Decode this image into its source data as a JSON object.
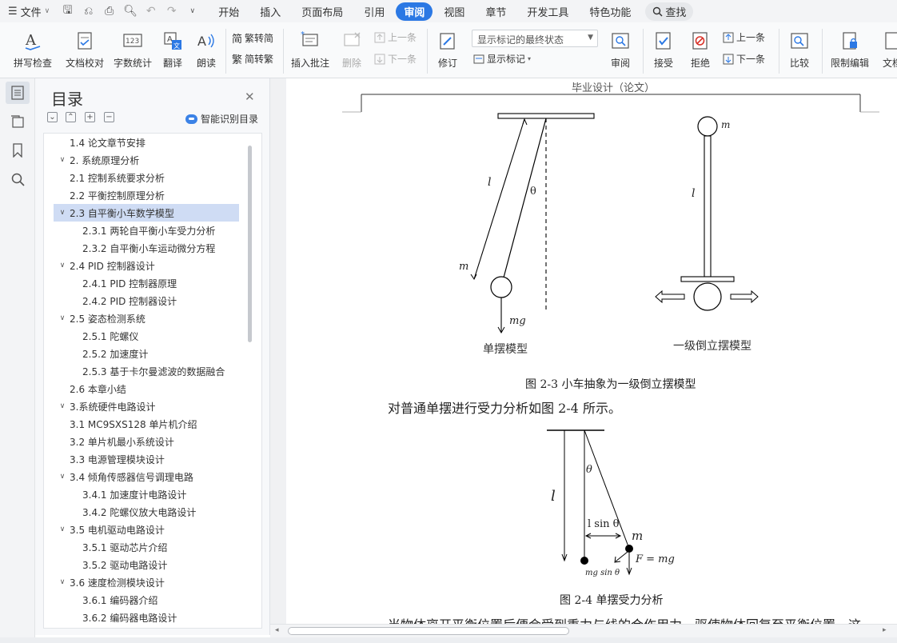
{
  "menubar": {
    "file_label": "文件",
    "tabs": [
      "开始",
      "插入",
      "页面布局",
      "引用",
      "审阅",
      "视图",
      "章节",
      "开发工具",
      "特色功能"
    ],
    "active_tab": "审阅",
    "search_label": "查找"
  },
  "ribbon": {
    "spell_check": "拼写检查",
    "doc_proof": "文档校对",
    "word_count": "字数统计",
    "translate": "翻译",
    "read_aloud": "朗读",
    "trad_to_simp": "繁转简",
    "simp_to_trad": "简转繁",
    "insert_comment": "插入批注",
    "delete": "删除",
    "prev_comment": "上一条",
    "next_comment": "下一条",
    "track_changes": "修订",
    "markup_mode": "显示标记的最终状态",
    "show_markup": "显示标记",
    "review": "审阅",
    "accept": "接受",
    "reject": "拒绝",
    "prev_change": "上一条",
    "next_change": "下一条",
    "compare": "比较",
    "restrict_edit": "限制编辑",
    "doc_rights": "文档"
  },
  "toc": {
    "title": "目录",
    "ai_label": "智能识别目录",
    "items": [
      {
        "label": "1.4 论文章节安排",
        "level": 2,
        "expand": ""
      },
      {
        "label": "2. 系统原理分析",
        "level": 1,
        "expand": "v"
      },
      {
        "label": "2.1 控制系统要求分析",
        "level": 2,
        "expand": ""
      },
      {
        "label": "2.2 平衡控制原理分析",
        "level": 2,
        "expand": ""
      },
      {
        "label": "2.3 自平衡小车数学模型",
        "level": 2,
        "expand": "v",
        "selected": true
      },
      {
        "label": "2.3.1 两轮自平衡小车受力分析",
        "level": 3,
        "expand": ""
      },
      {
        "label": "2.3.2 自平衡小车运动微分方程",
        "level": 3,
        "expand": ""
      },
      {
        "label": "2.4 PID 控制器设计",
        "level": 2,
        "expand": "v"
      },
      {
        "label": "2.4.1 PID 控制器原理",
        "level": 3,
        "expand": ""
      },
      {
        "label": "2.4.2 PID 控制器设计",
        "level": 3,
        "expand": ""
      },
      {
        "label": "2.5 姿态检测系统",
        "level": 2,
        "expand": "v"
      },
      {
        "label": "2.5.1 陀螺仪",
        "level": 3,
        "expand": ""
      },
      {
        "label": "2.5.2 加速度计",
        "level": 3,
        "expand": ""
      },
      {
        "label": "2.5.3 基于卡尔曼滤波的数据融合",
        "level": 3,
        "expand": ""
      },
      {
        "label": "2.6 本章小结",
        "level": 2,
        "expand": ""
      },
      {
        "label": "3.系统硬件电路设计",
        "level": 1,
        "expand": "v"
      },
      {
        "label": "3.1 MC9SXS128 单片机介绍",
        "level": 2,
        "expand": ""
      },
      {
        "label": "3.2 单片机最小系统设计",
        "level": 2,
        "expand": ""
      },
      {
        "label": "3.3 电源管理模块设计",
        "level": 2,
        "expand": ""
      },
      {
        "label": "3.4 倾角传感器信号调理电路",
        "level": 2,
        "expand": "v"
      },
      {
        "label": "3.4.1 加速度计电路设计",
        "level": 3,
        "expand": ""
      },
      {
        "label": "3.4.2 陀螺仪放大电路设计",
        "level": 3,
        "expand": ""
      },
      {
        "label": "3.5 电机驱动电路设计",
        "level": 2,
        "expand": "v"
      },
      {
        "label": "3.5.1 驱动芯片介绍",
        "level": 3,
        "expand": ""
      },
      {
        "label": "3.5.2 驱动电路设计",
        "level": 3,
        "expand": ""
      },
      {
        "label": "3.6 速度检测模块设计",
        "level": 2,
        "expand": "v"
      },
      {
        "label": "3.6.1 编码器介绍",
        "level": 3,
        "expand": ""
      },
      {
        "label": "3.6.2 编码器电路设计",
        "level": 3,
        "expand": ""
      }
    ]
  },
  "document": {
    "header": "毕业设计（论文）",
    "fig1": {
      "pendulum_caption": "单摆模型",
      "inverted_caption": "一级倒立摆模型",
      "caption": "图 2-3 小车抽象为一级倒立摆模型",
      "l": "l",
      "theta": "θ",
      "m": "m",
      "mg": "mg"
    },
    "paragraph1": "对普通单摆进行受力分析如图 2-4 所示。",
    "fig2": {
      "caption": "图 2-4 单摆受力分析",
      "l": "l",
      "theta": "θ",
      "lsin": "l sin θ",
      "m": "m",
      "force": "F = mg",
      "mgsin": "mg sin θ"
    },
    "paragraph2": "当物体离开平衡位置后便会受到重力与线的合作用力，驱使物体回复至平衡位置，这"
  },
  "colors": {
    "accent": "#2b78e4",
    "toc_selected": "#cfdcf4"
  }
}
